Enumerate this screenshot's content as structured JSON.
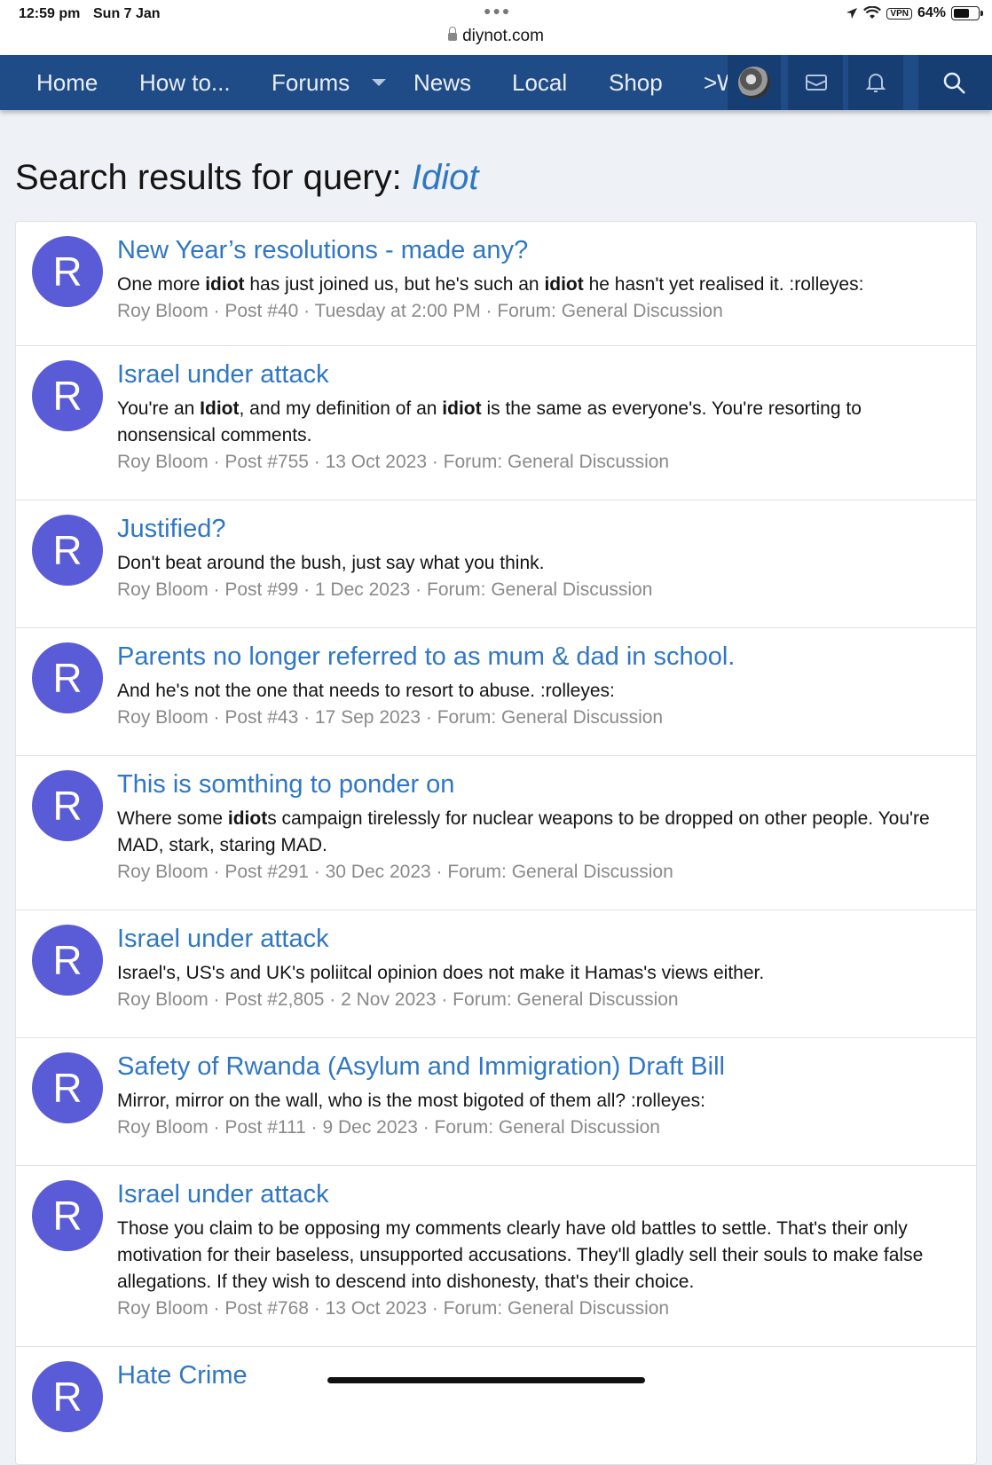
{
  "status_bar": {
    "time": "12:59 pm",
    "date": "Sun 7 Jan",
    "url": "diynot.com",
    "vpn": "VPN",
    "battery": "64%",
    "battery_fraction": 0.64
  },
  "nav": {
    "items": [
      "Home",
      "How to...",
      "Forums",
      "News",
      "Local",
      "Shop"
    ],
    "more": ">W"
  },
  "search": {
    "title_prefix": "Search results for query: ",
    "query": "Idiot"
  },
  "results": [
    {
      "avatar": "R",
      "title": "New Year’s resolutions - made any?",
      "snippet_html": "One more <b>idiot</b> has just joined us, but he's such an <b>idiot</b> he hasn't yet realised it. :rolleyes:",
      "meta": "Roy Bloom · Post #40 · Tuesday at 2:00 PM · Forum: General Discussion"
    },
    {
      "avatar": "R",
      "title": "Israel under attack",
      "snippet_html": "You're an <b>Idiot</b>, and my definition of an <b>idiot</b> is the same as everyone's. You're resorting to nonsensical comments.",
      "meta": "Roy Bloom · Post #755 · 13 Oct 2023 · Forum: General Discussion"
    },
    {
      "avatar": "R",
      "title": "Justified?",
      "snippet_html": "Don't beat around the bush, just say what you think.",
      "meta": "Roy Bloom · Post #99 · 1 Dec 2023 · Forum: General Discussion"
    },
    {
      "avatar": "R",
      "title": "Parents no longer referred to as mum & dad in school.",
      "snippet_html": "And he's not the one that needs to resort to abuse. :rolleyes:",
      "meta": "Roy Bloom · Post #43 · 17 Sep 2023 · Forum: General Discussion"
    },
    {
      "avatar": "R",
      "title": "This is somthing to ponder on",
      "snippet_html": "Where some <b>idiot</b>s campaign tirelessly for nuclear weapons to be dropped on other people. You're MAD, stark, staring MAD.",
      "meta": "Roy Bloom · Post #291 · 30 Dec 2023 · Forum: General Discussion"
    },
    {
      "avatar": "R",
      "title": "Israel under attack",
      "snippet_html": "Israel's, US's and UK's poliitcal opinion does not make it Hamas's views either.",
      "meta": "Roy Bloom · Post #2,805 · 2 Nov 2023 · Forum: General Discussion"
    },
    {
      "avatar": "R",
      "title": "Safety of Rwanda (Asylum and Immigration) Draft Bill",
      "snippet_html": "Mirror, mirror on the wall, who is the most bigoted of them all? :rolleyes:",
      "meta": "Roy Bloom · Post #111 · 9 Dec 2023 · Forum: General Discussion"
    },
    {
      "avatar": "R",
      "title": "Israel under attack",
      "snippet_html": "Those you claim to be opposing my comments clearly have old battles to settle. That's their only motivation for their baseless, unsupported accusations. They'll gladly sell their souls to make false allegations. If they wish to descend into dishonesty, that's their choice.",
      "meta": "Roy Bloom · Post #768 · 13 Oct 2023 · Forum: General Discussion"
    },
    {
      "avatar": "R",
      "title": "Hate Crime",
      "snippet_html": "",
      "meta": ""
    }
  ],
  "colors": {
    "nav_bg": "#1f4b86",
    "link": "#2f77c4",
    "avatar_bg": "#5a5bd6",
    "meta": "#8a8a8a"
  },
  "icons": [
    "lock-icon",
    "location-icon",
    "wifi-icon",
    "battery-icon",
    "chevron-down-icon",
    "user-avatar",
    "mail-icon",
    "bell-icon",
    "search-icon"
  ]
}
